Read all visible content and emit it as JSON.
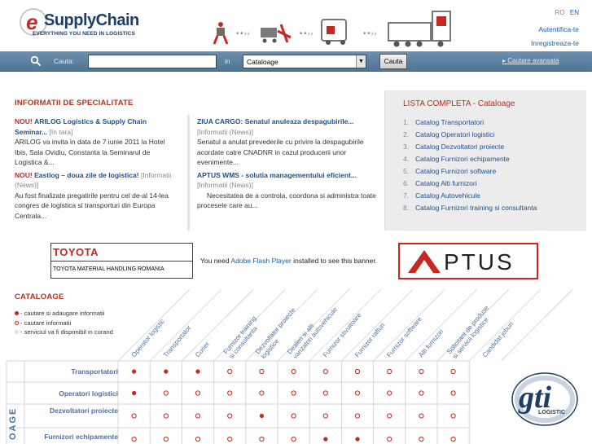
{
  "header": {
    "logo_e": "e",
    "logo_name": "SupplyChain",
    "logo_tagline": "EVERYTHING YOU NEED IN LOGISTICS",
    "languages": [
      "RO",
      "EN"
    ],
    "auth_link": "Autentifica-te",
    "register_link": "Inregistreaza-te"
  },
  "search": {
    "label": "Cauta:",
    "in_label": "in",
    "query_value": "",
    "category_selected": "Cataloage",
    "button_label": "Cauta",
    "advanced_link": "Cautare avansata",
    "icon": "search-icon"
  },
  "info": {
    "section_title": "INFORMATII DE SPECIALITATE",
    "col1": [
      {
        "badge": "NOU!",
        "title": "ARILOG Logistics & Supply Chain Seminar...",
        "tag": "[In tara]",
        "body": "ARILOG va invita in data de 7 iunie 2011 la Hotel Ibis, Sala Ovidiu, Constanta la Seminarul de Logistica &..."
      },
      {
        "badge": "NOU!",
        "title": "Eastlog – doua zile de logistica!",
        "tag": "[Informatii (News)]",
        "body": "Au fost finalizate pregatirile pentru cel de-al 14-lea congres de logistica si transporturi din Europa Centrala..."
      }
    ],
    "col2": [
      {
        "title": "ZIUA CARGO: Senatul anuleaza despagubirile...",
        "tag": "[Informatii (News)]",
        "body": "Senatul a anulat prevederile cu privire la despagubirile acordate catre CNADNR in cazul producerii unor evenimente..."
      },
      {
        "title": "APTUS WMS - solutia managementului eficient...",
        "tag": "[Informatii (News)]",
        "body": "Necesitatea de a controla, coordona si administra toate procesele care au..."
      }
    ]
  },
  "lista": {
    "title": "LISTA COMPLETA - Cataloage",
    "items": [
      {
        "n": "1.",
        "label": "Catalog Transportatori"
      },
      {
        "n": "2.",
        "label": "Catalog Operatori logistici"
      },
      {
        "n": "3.",
        "label": "Catalog Dezvoltatori proiecte"
      },
      {
        "n": "4.",
        "label": "Catalog Furnizori echipamente"
      },
      {
        "n": "5.",
        "label": "Catalog Furnizori software"
      },
      {
        "n": "6.",
        "label": "Catalog Alti furnizori"
      },
      {
        "n": "7.",
        "label": "Catalog Autovehicule"
      },
      {
        "n": "8.",
        "label": "Catalog Furnizori training si consultanta"
      }
    ]
  },
  "banners": {
    "toyota_name": "TOYOTA",
    "toyota_sub": "TOYOTA MATERIAL HANDLING ROMANIA",
    "flash_pre": "You need",
    "flash_link": "Adobe Flash Player",
    "flash_post": "installed to see this banner.",
    "aptus_name": "PTUS",
    "gti_name": "gti",
    "gti_sub": "LOGISTIC"
  },
  "catalog": {
    "title": "CATALOAGE",
    "legend": [
      {
        "text": "- cautare si adaugare informatii",
        "color": "#c62822",
        "filled": true
      },
      {
        "text": "- cautare informatii",
        "color": "#c62822",
        "filled": false
      },
      {
        "text": "- serviciul va fi disponibil in curand",
        "color": "#dddddd",
        "filled": true
      }
    ],
    "side_label": "OAGE",
    "columns": [
      "Operator logistic",
      "Transportator",
      "Curier",
      "Furnizor training si consultanta",
      "Dezvoltator proiecte logistice",
      "Dealeri si alti vanzatori autovehicule",
      "Furnizor stivuitoare",
      "Furnizor rafturi",
      "Furnizor software",
      "Alti furnizori",
      "Solicitant de produse si servicii logistice",
      "Candidat joburi"
    ],
    "rows": [
      {
        "label": "Transportatori",
        "cells": [
          "F",
          "F",
          "F",
          "O",
          "O",
          "O",
          "O",
          "O",
          "O",
          "O",
          "O"
        ]
      },
      {
        "label": "Operatori logistici",
        "cells": [
          "F",
          "O",
          "O",
          "O",
          "O",
          "O",
          "O",
          "O",
          "O",
          "O",
          "O"
        ]
      },
      {
        "label": "Dezvoltatori proiecte",
        "cells": [
          "O",
          "O",
          "O",
          "O",
          "F",
          "O",
          "O",
          "O",
          "O",
          "O",
          "O"
        ]
      },
      {
        "label": "Furnizori echipamente",
        "cells": [
          "O",
          "O",
          "O",
          "O",
          "O",
          "O",
          "F",
          "F",
          "O",
          "O",
          "O"
        ]
      }
    ]
  }
}
